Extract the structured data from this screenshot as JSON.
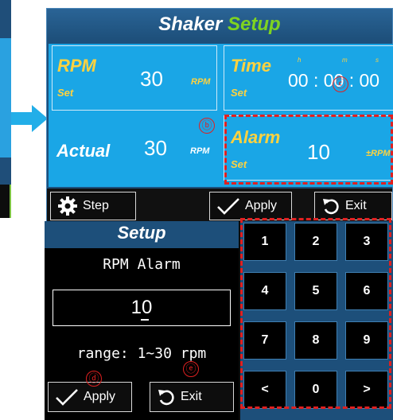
{
  "shaker": {
    "title_part1": "Shaker",
    "title_part2": "Setup",
    "rpm": {
      "label": "RPM",
      "set_label": "Set",
      "value": "30",
      "unit": "RPM"
    },
    "time": {
      "label": "Time",
      "set_label": "Set",
      "value": "00 : 00 : 00",
      "h": "h",
      "m": "m",
      "s": "s"
    },
    "actual": {
      "label": "Actual",
      "value": "30",
      "unit": "RPM"
    },
    "alarm": {
      "label": "Alarm",
      "set_label": "Set",
      "value": "10",
      "unit": "±RPM"
    },
    "buttons": {
      "step": "Step",
      "apply": "Apply",
      "exit": "Exit"
    }
  },
  "annotations": {
    "b": "ⓑ",
    "c": "ⓒ",
    "d": "ⓓ",
    "e": "ⓔ"
  },
  "setup": {
    "title": "Setup",
    "field_label": "RPM Alarm",
    "value": "10",
    "range": "range: 1~30 rpm",
    "buttons": {
      "apply": "Apply",
      "exit": "Exit"
    }
  },
  "keypad": {
    "keys": [
      "1",
      "2",
      "3",
      "4",
      "5",
      "6",
      "7",
      "8",
      "9",
      "<",
      "0",
      ">"
    ]
  },
  "colors": {
    "header": "#1d4f7a",
    "panel": "#1aa6e6",
    "label": "#ffd23f",
    "accent_green": "#7ed321",
    "annotation_red": "#e02020"
  }
}
